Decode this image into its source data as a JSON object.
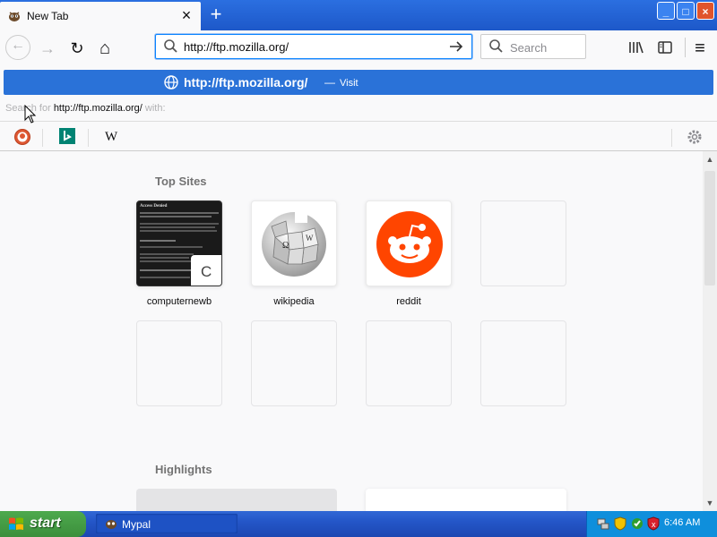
{
  "tab": {
    "title": "New Tab",
    "close_glyph": "×"
  },
  "newtab_glyph": "+",
  "window_controls": {
    "minimize": "_",
    "maximize": "□",
    "close": "×"
  },
  "nav": {
    "back_icon": "←",
    "forward_icon": "→",
    "reload_icon": "↻",
    "home_icon": "⌂",
    "url_value": "http://ftp.mozilla.org/",
    "search_placeholder": "Search",
    "menu_icon": "≡"
  },
  "autocomplete": {
    "url": "http://ftp.mozilla.org/",
    "separator": "—",
    "action": "Visit",
    "search_prefix": "Search for ",
    "search_term": "http://ftp.mozilla.org/",
    "search_suffix": " with:"
  },
  "engines": [
    {
      "name": "duckduckgo-icon"
    },
    {
      "name": "bing-icon"
    },
    {
      "name": "wikipedia-icon",
      "glyph": "W"
    }
  ],
  "top_sites": {
    "title": "Top Sites",
    "tiles": [
      {
        "label": "computernewb",
        "kind": "screenshot"
      },
      {
        "label": "wikipedia",
        "kind": "logo"
      },
      {
        "label": "reddit",
        "kind": "logo"
      },
      {
        "label": "",
        "kind": "empty"
      },
      {
        "label": "",
        "kind": "empty"
      },
      {
        "label": "",
        "kind": "empty"
      },
      {
        "label": "",
        "kind": "empty"
      },
      {
        "label": "",
        "kind": "empty"
      }
    ],
    "screenshot_heading": "Access Denied",
    "overlay_letter": "C"
  },
  "highlights": {
    "title": "Highlights"
  },
  "taskbar": {
    "start_label": "start",
    "item_label": "Mypal",
    "clock": "6:46 AM"
  },
  "colors": {
    "accent": "#0a84ff",
    "popup_highlight": "#2a72d8",
    "reddit": "#ff4500",
    "xp_blue": "#2456c8",
    "xp_green": "#3c8f3c"
  }
}
